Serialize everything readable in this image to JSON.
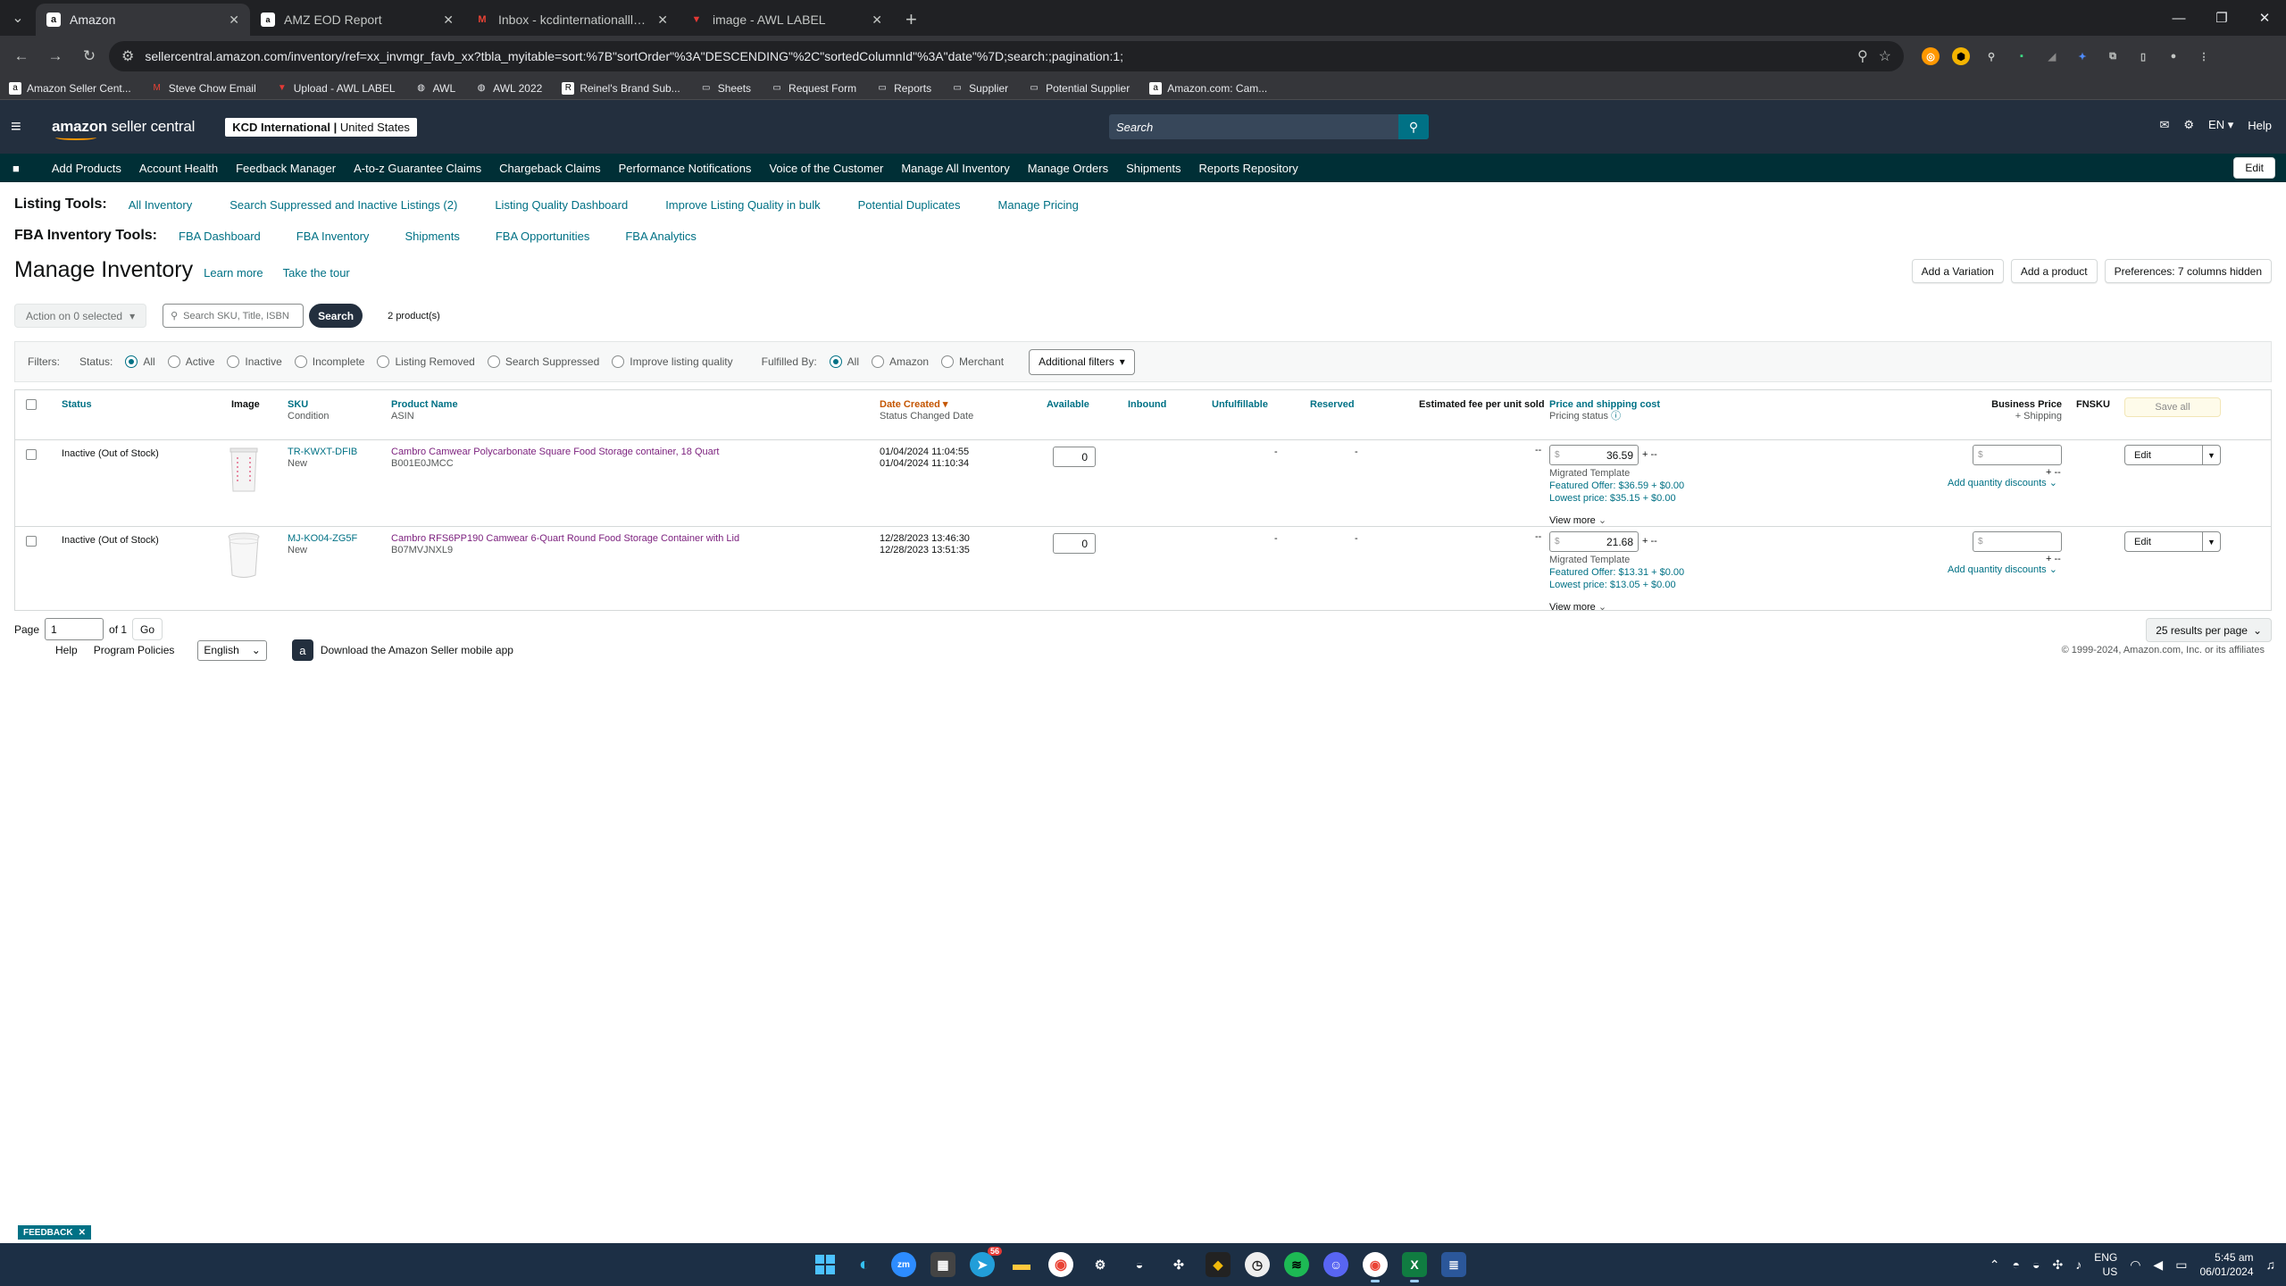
{
  "browser": {
    "tabs": [
      {
        "title": "Amazon",
        "active": true,
        "favicon": "a"
      },
      {
        "title": "AMZ EOD Report",
        "active": false,
        "favicon": "sheets-icon"
      },
      {
        "title": "Inbox - kcdinternationalllc@gm",
        "active": false,
        "favicon": "gmail-icon"
      },
      {
        "title": "image - AWL LABEL",
        "active": false,
        "favicon": "awl-icon"
      }
    ],
    "url": "sellercentral.amazon.com/inventory/ref=xx_invmgr_favb_xx?tbla_myitable=sort:%7B\"sortOrder\"%3A\"DESCENDING\"%2C\"sortedColumnId\"%3A\"date\"%7D;search:;pagination:1;",
    "bookmarks": [
      "Amazon Seller Cent...",
      "Steve Chow Email",
      "Upload - AWL LABEL",
      "AWL",
      "AWL 2022",
      "Reinel's Brand Sub...",
      "Sheets",
      "Request Form",
      "Reports",
      "Supplier",
      "Potential Supplier",
      "Amazon.com: Cam..."
    ]
  },
  "header": {
    "logo": "amazon",
    "logo_sub": "seller central",
    "account": "KCD International",
    "marketplace": "United States",
    "search_placeholder": "Search",
    "lang": "EN",
    "help": "Help"
  },
  "menu": {
    "items": [
      "Add Products",
      "Account Health",
      "Feedback Manager",
      "A-to-z Guarantee Claims",
      "Chargeback Claims",
      "Performance Notifications",
      "Voice of the Customer",
      "Manage All Inventory",
      "Manage Orders",
      "Shipments",
      "Reports Repository"
    ],
    "edit": "Edit"
  },
  "listing_tools": {
    "label": "Listing Tools:",
    "links": [
      "All Inventory",
      "Search Suppressed and Inactive Listings (2)",
      "Listing Quality Dashboard",
      "Improve Listing Quality in bulk",
      "Potential Duplicates",
      "Manage Pricing"
    ]
  },
  "fba_tools": {
    "label": "FBA Inventory Tools:",
    "links": [
      "FBA Dashboard",
      "FBA Inventory",
      "Shipments",
      "FBA Opportunities",
      "FBA Analytics"
    ]
  },
  "page": {
    "title": "Manage Inventory",
    "learn_more": "Learn more",
    "tour": "Take the tour",
    "buttons": [
      "Add a Variation",
      "Add a product",
      "Preferences: 7 columns hidden"
    ],
    "action": "Action on 0 selected",
    "search_placeholder": "Search SKU, Title, ISBN",
    "search_btn": "Search",
    "count": "2 product(s)"
  },
  "filters": {
    "label": "Filters:",
    "status_label": "Status:",
    "status": [
      "All",
      "Active",
      "Inactive",
      "Incomplete",
      "Listing Removed",
      "Search Suppressed",
      "Improve listing quality"
    ],
    "fulfilled_label": "Fulfilled By:",
    "fulfilled": [
      "All",
      "Amazon",
      "Merchant"
    ],
    "additional": "Additional filters"
  },
  "table": {
    "headers": {
      "status": "Status",
      "image": "Image",
      "sku": "SKU",
      "condition": "Condition",
      "product_name": "Product Name",
      "asin": "ASIN",
      "date_created": "Date Created",
      "status_changed": "Status Changed Date",
      "available": "Available",
      "inbound": "Inbound",
      "unfulfillable": "Unfulfillable",
      "reserved": "Reserved",
      "fee": "Estimated fee per unit sold",
      "price": "Price and shipping cost",
      "pricing_status": "Pricing status",
      "business_price": "Business Price",
      "shipping": "+ Shipping",
      "fnsku": "FNSKU",
      "save_all": "Save all"
    },
    "rows": [
      {
        "status": "Inactive (Out of Stock)",
        "sku": "TR-KWXT-DFIB",
        "condition": "New",
        "name": "Cambro Camwear Polycarbonate Square Food Storage container, 18 Quart",
        "asin": "B001E0JMCC",
        "created": "01/04/2024 11:04:55",
        "changed": "01/04/2024 11:10:34",
        "available": "0",
        "unfulfillable": "-",
        "reserved": "-",
        "fee": "--",
        "price": "36.59",
        "price_ship": "+ --",
        "template": "Migrated Template",
        "featured": "Featured Offer: $36.59 + $0.00",
        "lowest": "Lowest price: $35.15 + $0.00",
        "view_more": "View more",
        "bp_ship": "+ --",
        "qty_disc": "Add quantity discounts",
        "edit": "Edit"
      },
      {
        "status": "Inactive (Out of Stock)",
        "sku": "MJ-KO04-ZG5F",
        "condition": "New",
        "name": "Cambro RFS6PP190 Camwear 6-Quart Round Food Storage Container with Lid",
        "asin": "B07MVJNXL9",
        "created": "12/28/2023 13:46:30",
        "changed": "12/28/2023 13:51:35",
        "available": "0",
        "unfulfillable": "-",
        "reserved": "-",
        "fee": "--",
        "price": "21.68",
        "price_ship": "+ --",
        "template": "Migrated Template",
        "featured": "Featured Offer: $13.31 + $0.00",
        "lowest": "Lowest price: $13.05 + $0.00",
        "view_more": "View more",
        "bp_ship": "+ --",
        "qty_disc": "Add quantity discounts",
        "edit": "Edit"
      }
    ]
  },
  "pager": {
    "label": "Page",
    "value": "1",
    "of": "of 1",
    "go": "Go",
    "per_page": "25 results per page"
  },
  "footer": {
    "help": "Help",
    "policies": "Program Policies",
    "language": "English",
    "app": "Download the Amazon Seller mobile app",
    "copyright": "© 1999-2024, Amazon.com, Inc. or its affiliates"
  },
  "feedback": "FEEDBACK",
  "taskbar": {
    "lang": "ENG",
    "region": "US",
    "time": "5:45 am",
    "date": "06/01/2024",
    "badge": "56"
  },
  "colors": {
    "header": "#232f3e",
    "menu": "#002f36",
    "link": "#007185",
    "accent": "#ff9900",
    "visited": "#7b1f7d"
  }
}
